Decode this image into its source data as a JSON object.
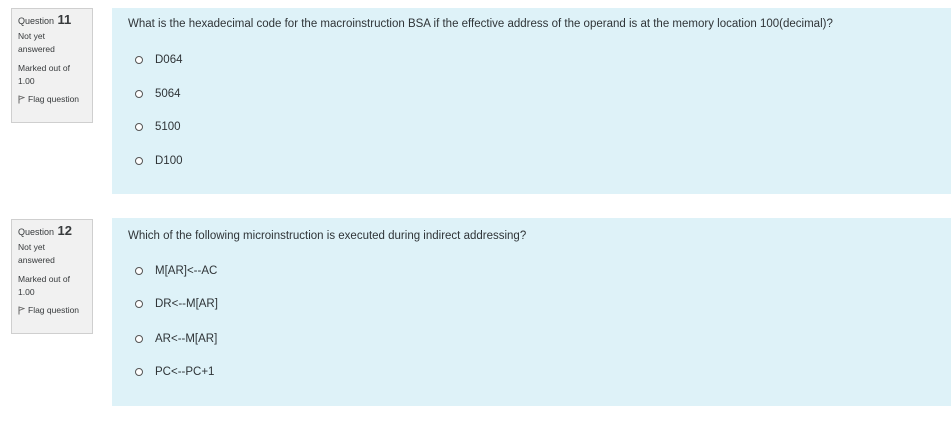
{
  "questions": [
    {
      "label": "Question",
      "number": "11",
      "state_line1": "Not yet",
      "state_line2": "answered",
      "marked_line1": "Marked out of",
      "marked_line2": "1.00",
      "flag_label": "Flag question",
      "text": "What is the hexadecimal code for the macroinstruction BSA if the effective address of the operand is at the memory location 100(decimal)?",
      "options": [
        "D064",
        "5064",
        "5100",
        "D100"
      ]
    },
    {
      "label": "Question",
      "number": "12",
      "state_line1": "Not yet",
      "state_line2": "answered",
      "marked_line1": "Marked out of",
      "marked_line2": "1.00",
      "flag_label": "Flag question",
      "text": "Which of the following microinstruction is executed during indirect addressing?",
      "options": [
        "M[AR]<--AC",
        "DR<--M[AR]",
        "AR<--M[AR]",
        "PC<--PC+1"
      ]
    }
  ]
}
